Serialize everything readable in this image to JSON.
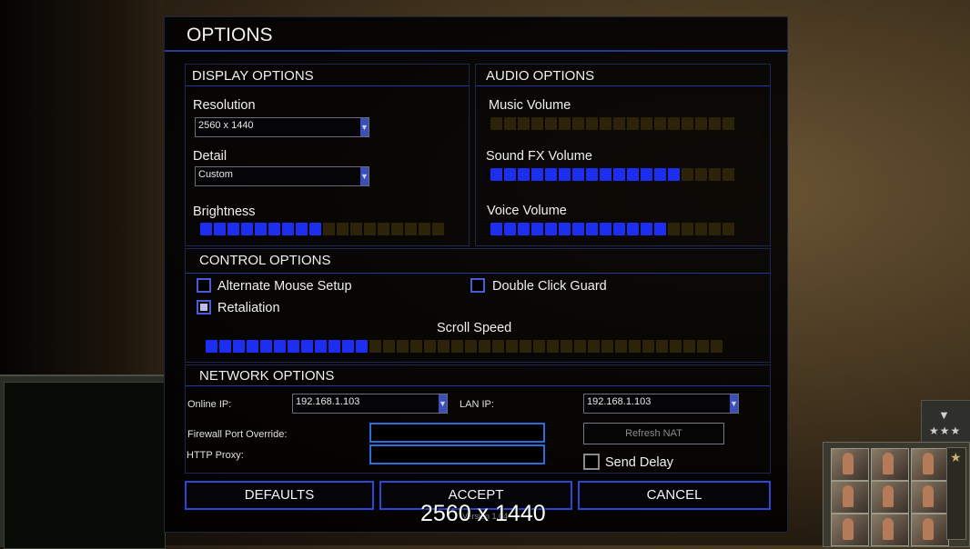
{
  "dialog": {
    "title": "OPTIONS"
  },
  "display": {
    "title": "DISPLAY OPTIONS",
    "resolution_label": "Resolution",
    "resolution_value": "2560 x 1440",
    "detail_label": "Detail",
    "detail_value": "Custom",
    "brightness_label": "Brightness",
    "brightness_level": 0.5
  },
  "audio": {
    "title": "AUDIO OPTIONS",
    "music_label": "Music Volume",
    "music_level": 0,
    "sfx_label": "Sound FX Volume",
    "sfx_level": 0.8,
    "voice_label": "Voice Volume",
    "voice_level": 0.7
  },
  "control": {
    "title": "CONTROL OPTIONS",
    "alt_mouse_label": "Alternate Mouse Setup",
    "alt_mouse_checked": false,
    "double_click_label": "Double Click Guard",
    "double_click_checked": false,
    "retaliation_label": "Retaliation",
    "retaliation_checked": true,
    "scroll_label": "Scroll Speed",
    "scroll_level": 0.32
  },
  "network": {
    "title": "NETWORK OPTIONS",
    "online_ip_label": "Online IP:",
    "online_ip_value": "192.168.1.103",
    "lan_ip_label": "LAN IP:",
    "lan_ip_value": "192.168.1.103",
    "firewall_label": "Firewall Port Override:",
    "firewall_value": "",
    "proxy_label": "HTTP Proxy:",
    "proxy_value": "",
    "refresh_nat_label": "Refresh NAT",
    "send_delay_label": "Send Delay",
    "send_delay_checked": false
  },
  "buttons": {
    "defaults": "DEFAULTS",
    "accept": "ACCEPT",
    "cancel": "CANCEL"
  },
  "footer": {
    "resolution_text": "2560 x 1440",
    "version_text": "Version 1.04"
  },
  "colors": {
    "accent": "#1e2ef0",
    "segment_off": "#2d2308",
    "border": "#2b47d8"
  },
  "sidebar": {
    "rank_icon": "star-icon",
    "scroll_icon": "chevron-down-icon"
  }
}
